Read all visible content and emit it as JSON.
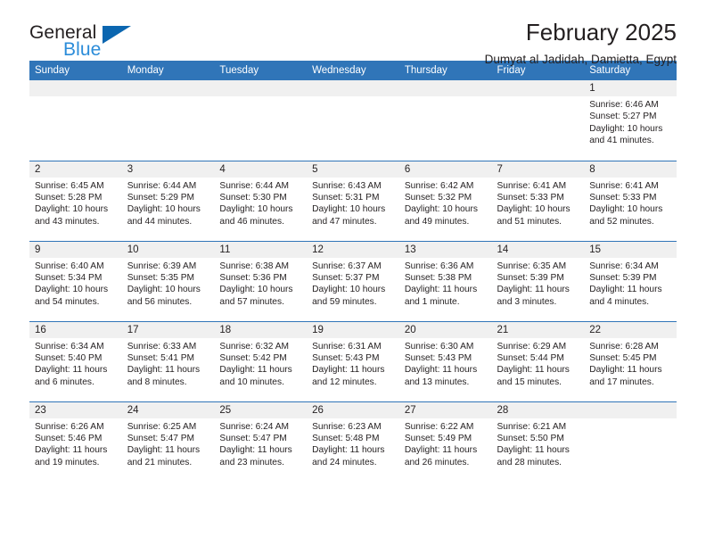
{
  "brand": {
    "name_part1": "General",
    "name_part2": "Blue",
    "accent_color": "#2b8cd9",
    "logo_triangle_color": "#0b66b0"
  },
  "header": {
    "title": "February 2025",
    "subtitle": "Dumyat al Jadidah, Damietta, Egypt"
  },
  "calendar": {
    "header_background": "#3075b8",
    "daynum_background": "#f0f0f0",
    "weekdays": [
      "Sunday",
      "Monday",
      "Tuesday",
      "Wednesday",
      "Thursday",
      "Friday",
      "Saturday"
    ],
    "weeks": [
      [
        {
          "day": "",
          "sunrise": "",
          "sunset": "",
          "daylight_line1": "",
          "daylight_line2": "",
          "empty": true
        },
        {
          "day": "",
          "sunrise": "",
          "sunset": "",
          "daylight_line1": "",
          "daylight_line2": "",
          "empty": true
        },
        {
          "day": "",
          "sunrise": "",
          "sunset": "",
          "daylight_line1": "",
          "daylight_line2": "",
          "empty": true
        },
        {
          "day": "",
          "sunrise": "",
          "sunset": "",
          "daylight_line1": "",
          "daylight_line2": "",
          "empty": true
        },
        {
          "day": "",
          "sunrise": "",
          "sunset": "",
          "daylight_line1": "",
          "daylight_line2": "",
          "empty": true
        },
        {
          "day": "",
          "sunrise": "",
          "sunset": "",
          "daylight_line1": "",
          "daylight_line2": "",
          "empty": true
        },
        {
          "day": "1",
          "sunrise": "Sunrise: 6:46 AM",
          "sunset": "Sunset: 5:27 PM",
          "daylight_line1": "Daylight: 10 hours",
          "daylight_line2": "and 41 minutes."
        }
      ],
      [
        {
          "day": "2",
          "sunrise": "Sunrise: 6:45 AM",
          "sunset": "Sunset: 5:28 PM",
          "daylight_line1": "Daylight: 10 hours",
          "daylight_line2": "and 43 minutes."
        },
        {
          "day": "3",
          "sunrise": "Sunrise: 6:44 AM",
          "sunset": "Sunset: 5:29 PM",
          "daylight_line1": "Daylight: 10 hours",
          "daylight_line2": "and 44 minutes."
        },
        {
          "day": "4",
          "sunrise": "Sunrise: 6:44 AM",
          "sunset": "Sunset: 5:30 PM",
          "daylight_line1": "Daylight: 10 hours",
          "daylight_line2": "and 46 minutes."
        },
        {
          "day": "5",
          "sunrise": "Sunrise: 6:43 AM",
          "sunset": "Sunset: 5:31 PM",
          "daylight_line1": "Daylight: 10 hours",
          "daylight_line2": "and 47 minutes."
        },
        {
          "day": "6",
          "sunrise": "Sunrise: 6:42 AM",
          "sunset": "Sunset: 5:32 PM",
          "daylight_line1": "Daylight: 10 hours",
          "daylight_line2": "and 49 minutes."
        },
        {
          "day": "7",
          "sunrise": "Sunrise: 6:41 AM",
          "sunset": "Sunset: 5:33 PM",
          "daylight_line1": "Daylight: 10 hours",
          "daylight_line2": "and 51 minutes."
        },
        {
          "day": "8",
          "sunrise": "Sunrise: 6:41 AM",
          "sunset": "Sunset: 5:33 PM",
          "daylight_line1": "Daylight: 10 hours",
          "daylight_line2": "and 52 minutes."
        }
      ],
      [
        {
          "day": "9",
          "sunrise": "Sunrise: 6:40 AM",
          "sunset": "Sunset: 5:34 PM",
          "daylight_line1": "Daylight: 10 hours",
          "daylight_line2": "and 54 minutes."
        },
        {
          "day": "10",
          "sunrise": "Sunrise: 6:39 AM",
          "sunset": "Sunset: 5:35 PM",
          "daylight_line1": "Daylight: 10 hours",
          "daylight_line2": "and 56 minutes."
        },
        {
          "day": "11",
          "sunrise": "Sunrise: 6:38 AM",
          "sunset": "Sunset: 5:36 PM",
          "daylight_line1": "Daylight: 10 hours",
          "daylight_line2": "and 57 minutes."
        },
        {
          "day": "12",
          "sunrise": "Sunrise: 6:37 AM",
          "sunset": "Sunset: 5:37 PM",
          "daylight_line1": "Daylight: 10 hours",
          "daylight_line2": "and 59 minutes."
        },
        {
          "day": "13",
          "sunrise": "Sunrise: 6:36 AM",
          "sunset": "Sunset: 5:38 PM",
          "daylight_line1": "Daylight: 11 hours",
          "daylight_line2": "and 1 minute."
        },
        {
          "day": "14",
          "sunrise": "Sunrise: 6:35 AM",
          "sunset": "Sunset: 5:39 PM",
          "daylight_line1": "Daylight: 11 hours",
          "daylight_line2": "and 3 minutes."
        },
        {
          "day": "15",
          "sunrise": "Sunrise: 6:34 AM",
          "sunset": "Sunset: 5:39 PM",
          "daylight_line1": "Daylight: 11 hours",
          "daylight_line2": "and 4 minutes."
        }
      ],
      [
        {
          "day": "16",
          "sunrise": "Sunrise: 6:34 AM",
          "sunset": "Sunset: 5:40 PM",
          "daylight_line1": "Daylight: 11 hours",
          "daylight_line2": "and 6 minutes."
        },
        {
          "day": "17",
          "sunrise": "Sunrise: 6:33 AM",
          "sunset": "Sunset: 5:41 PM",
          "daylight_line1": "Daylight: 11 hours",
          "daylight_line2": "and 8 minutes."
        },
        {
          "day": "18",
          "sunrise": "Sunrise: 6:32 AM",
          "sunset": "Sunset: 5:42 PM",
          "daylight_line1": "Daylight: 11 hours",
          "daylight_line2": "and 10 minutes."
        },
        {
          "day": "19",
          "sunrise": "Sunrise: 6:31 AM",
          "sunset": "Sunset: 5:43 PM",
          "daylight_line1": "Daylight: 11 hours",
          "daylight_line2": "and 12 minutes."
        },
        {
          "day": "20",
          "sunrise": "Sunrise: 6:30 AM",
          "sunset": "Sunset: 5:43 PM",
          "daylight_line1": "Daylight: 11 hours",
          "daylight_line2": "and 13 minutes."
        },
        {
          "day": "21",
          "sunrise": "Sunrise: 6:29 AM",
          "sunset": "Sunset: 5:44 PM",
          "daylight_line1": "Daylight: 11 hours",
          "daylight_line2": "and 15 minutes."
        },
        {
          "day": "22",
          "sunrise": "Sunrise: 6:28 AM",
          "sunset": "Sunset: 5:45 PM",
          "daylight_line1": "Daylight: 11 hours",
          "daylight_line2": "and 17 minutes."
        }
      ],
      [
        {
          "day": "23",
          "sunrise": "Sunrise: 6:26 AM",
          "sunset": "Sunset: 5:46 PM",
          "daylight_line1": "Daylight: 11 hours",
          "daylight_line2": "and 19 minutes."
        },
        {
          "day": "24",
          "sunrise": "Sunrise: 6:25 AM",
          "sunset": "Sunset: 5:47 PM",
          "daylight_line1": "Daylight: 11 hours",
          "daylight_line2": "and 21 minutes."
        },
        {
          "day": "25",
          "sunrise": "Sunrise: 6:24 AM",
          "sunset": "Sunset: 5:47 PM",
          "daylight_line1": "Daylight: 11 hours",
          "daylight_line2": "and 23 minutes."
        },
        {
          "day": "26",
          "sunrise": "Sunrise: 6:23 AM",
          "sunset": "Sunset: 5:48 PM",
          "daylight_line1": "Daylight: 11 hours",
          "daylight_line2": "and 24 minutes."
        },
        {
          "day": "27",
          "sunrise": "Sunrise: 6:22 AM",
          "sunset": "Sunset: 5:49 PM",
          "daylight_line1": "Daylight: 11 hours",
          "daylight_line2": "and 26 minutes."
        },
        {
          "day": "28",
          "sunrise": "Sunrise: 6:21 AM",
          "sunset": "Sunset: 5:50 PM",
          "daylight_line1": "Daylight: 11 hours",
          "daylight_line2": "and 28 minutes."
        },
        {
          "day": "",
          "sunrise": "",
          "sunset": "",
          "daylight_line1": "",
          "daylight_line2": "",
          "empty": true
        }
      ]
    ]
  }
}
